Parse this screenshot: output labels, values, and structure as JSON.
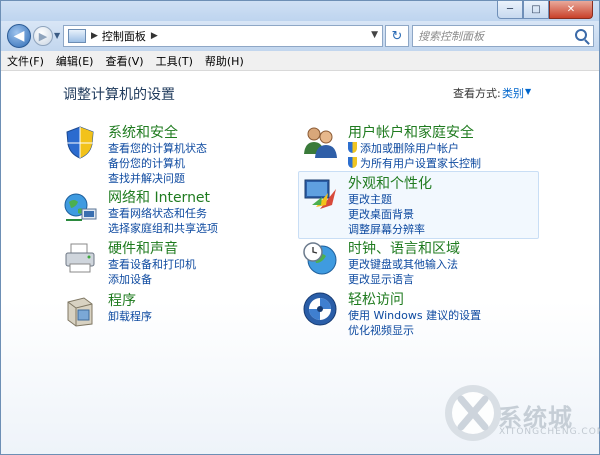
{
  "window": {
    "controls": {
      "minimize": "─",
      "maximize": "□",
      "close": "✕"
    }
  },
  "navbar": {
    "back": "◀",
    "forward": "▶",
    "address": "控制面板",
    "search_placeholder": "搜索控制面板"
  },
  "menu": [
    "文件(F)",
    "编辑(E)",
    "查看(V)",
    "工具(T)",
    "帮助(H)"
  ],
  "content": {
    "title": "调整计算机的设置",
    "view_by_label": "查看方式:",
    "view_by_value": "类别"
  },
  "categories": [
    {
      "title": "系统和安全",
      "icon": "shield-icon",
      "links": [
        "查看您的计算机状态",
        "备份您的计算机",
        "查找并解决问题"
      ]
    },
    {
      "title": "网络和 Internet",
      "icon": "network-globe-icon",
      "links": [
        "查看网络状态和任务",
        "选择家庭组和共享选项"
      ]
    },
    {
      "title": "硬件和声音",
      "icon": "printer-icon",
      "links": [
        "查看设备和打印机",
        "添加设备"
      ]
    },
    {
      "title": "程序",
      "icon": "programs-icon",
      "links": [
        "卸载程序"
      ]
    },
    {
      "title": "用户帐户和家庭安全",
      "icon": "users-icon",
      "links": [
        "添加或删除用户帐户",
        "为所有用户设置家长控制"
      ]
    },
    {
      "title": "外观和个性化",
      "icon": "appearance-icon",
      "links": [
        "更改主题",
        "更改桌面背景",
        "调整屏幕分辨率"
      ]
    },
    {
      "title": "时钟、语言和区域",
      "icon": "clock-globe-icon",
      "links": [
        "更改键盘或其他输入法",
        "更改显示语言"
      ]
    },
    {
      "title": "轻松访问",
      "icon": "ease-of-access-icon",
      "links": [
        "使用 Windows 建议的设置",
        "优化视频显示"
      ]
    }
  ],
  "watermark": {
    "text": "系统城",
    "sub": "XITONGCHENG.COM"
  }
}
